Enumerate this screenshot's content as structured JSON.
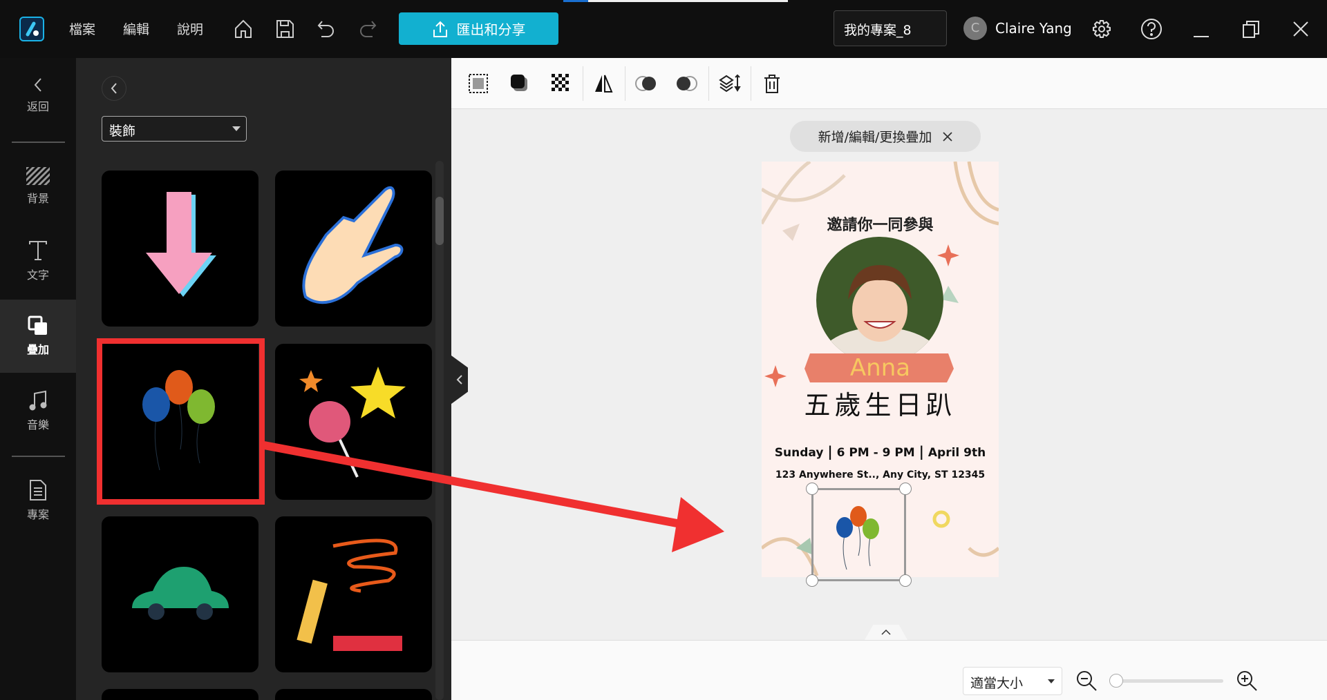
{
  "topbar": {
    "menu": [
      "檔案",
      "編輯",
      "說明"
    ],
    "export_label": "匯出和分享",
    "project_name": "我的專案_8",
    "user_initial": "C",
    "user_name": "Claire Yang"
  },
  "nav": {
    "back": "返回",
    "items": [
      "背景",
      "文字",
      "疊加",
      "音樂",
      "專案"
    ],
    "active": "疊加"
  },
  "panel": {
    "category": "裝飾",
    "stickers": [
      "pink-down-arrow",
      "pointing-hand",
      "balloons",
      "star-lollipop",
      "green-car",
      "crayon-scribble"
    ]
  },
  "canvas": {
    "overlay_hint": "新增/編輯/更換疊加"
  },
  "card": {
    "title": "邀請你一同參與",
    "name": "Anna",
    "headline": "五歲生日趴",
    "day": "Sunday",
    "time": "6 PM - 9 PM",
    "date": "April 9th",
    "address": "123 Anywhere St.., Any City, ST 12345"
  },
  "bottom": {
    "zoom_option": "適當大小",
    "zoom_level": 0
  },
  "colors": {
    "accent": "#12b0d0",
    "highlight": "#f03030"
  }
}
